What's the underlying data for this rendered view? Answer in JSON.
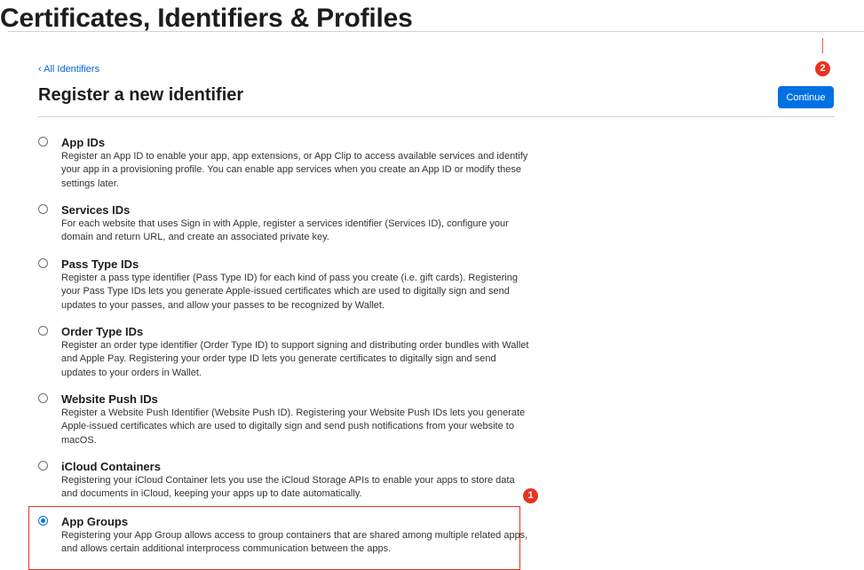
{
  "header": {
    "title": "Certificates, Identifiers & Profiles"
  },
  "nav": {
    "back_link": "‹ All Identifiers"
  },
  "section": {
    "title": "Register a new identifier",
    "continue_label": "Continue"
  },
  "annotations": {
    "badge_1": "1",
    "badge_2": "2"
  },
  "options": [
    {
      "label": "App IDs",
      "selected": false,
      "description": "Register an App ID to enable your app, app extensions, or App Clip to access available services and identify your app in a provisioning profile. You can enable app services when you create an App ID or modify these settings later."
    },
    {
      "label": "Services IDs",
      "selected": false,
      "description": "For each website that uses Sign in with Apple, register a services identifier (Services ID), configure your domain and return URL, and create an associated private key."
    },
    {
      "label": "Pass Type IDs",
      "selected": false,
      "description": "Register a pass type identifier (Pass Type ID) for each kind of pass you create (i.e. gift cards). Registering your Pass Type IDs lets you generate Apple-issued certificates which are used to digitally sign and send updates to your passes, and allow your passes to be recognized by Wallet."
    },
    {
      "label": "Order Type IDs",
      "selected": false,
      "description": "Register an order type identifier (Order Type ID) to support signing and distributing order bundles with Wallet and Apple Pay. Registering your order type ID lets you generate certificates to digitally sign and send updates to your orders in Wallet."
    },
    {
      "label": "Website Push IDs",
      "selected": false,
      "description": "Register a Website Push Identifier (Website Push ID). Registering your Website Push IDs lets you generate Apple-issued certificates which are used to digitally sign and send push notifications from your website to macOS."
    },
    {
      "label": "iCloud Containers",
      "selected": false,
      "description": "Registering your iCloud Container lets you use the iCloud Storage APIs to enable your apps to store data and documents in iCloud, keeping your apps up to date automatically."
    },
    {
      "label": "App Groups",
      "selected": true,
      "description": "Registering your App Group allows access to group containers that are shared among multiple related apps, and allows certain additional interprocess communication between the apps."
    }
  ],
  "colors": {
    "accent": "#0071e3",
    "link": "#0066cc",
    "annotation": "#e8331f"
  }
}
